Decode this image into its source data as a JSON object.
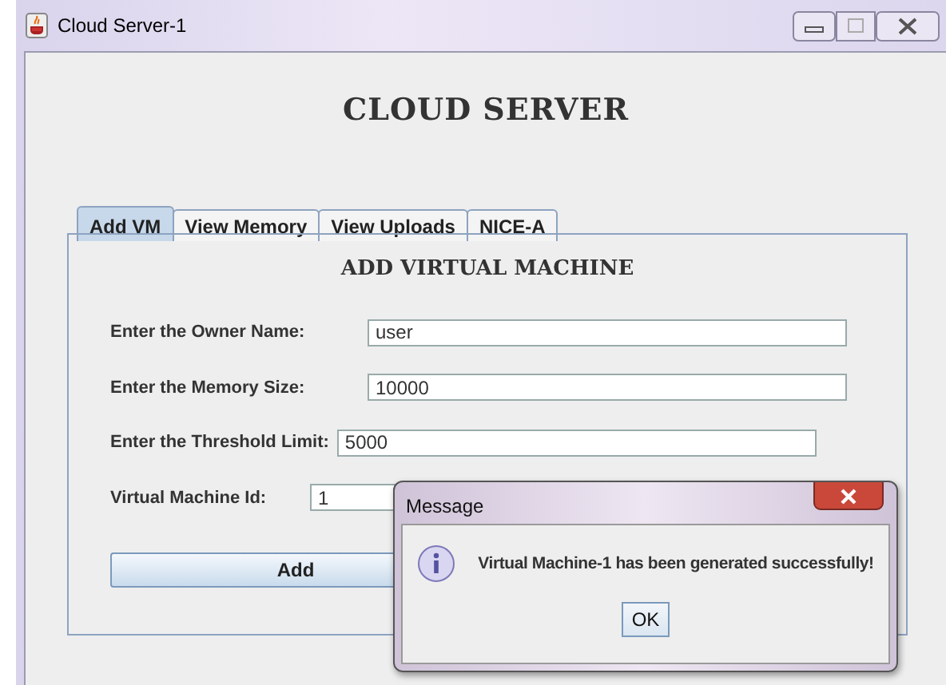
{
  "window": {
    "title": "Cloud Server-1"
  },
  "heading": "CLOUD SERVER",
  "tabs": [
    {
      "label": "Add VM",
      "selected": true
    },
    {
      "label": "View Memory",
      "selected": false
    },
    {
      "label": "View Uploads",
      "selected": false
    },
    {
      "label": "NICE-A",
      "selected": false
    }
  ],
  "panel": {
    "heading": "ADD VIRTUAL MACHINE",
    "fields": [
      {
        "label": "Enter the Owner Name:",
        "value": "user"
      },
      {
        "label": "Enter the Memory Size:",
        "value": "10000"
      },
      {
        "label": "Enter the Threshold Limit:",
        "value": "5000"
      },
      {
        "label": "Virtual Machine Id:",
        "value": "1"
      }
    ],
    "button": "Add"
  },
  "dialog": {
    "title": "Message",
    "message": "Virtual Machine-1 has been generated successfully!",
    "button": "OK"
  }
}
